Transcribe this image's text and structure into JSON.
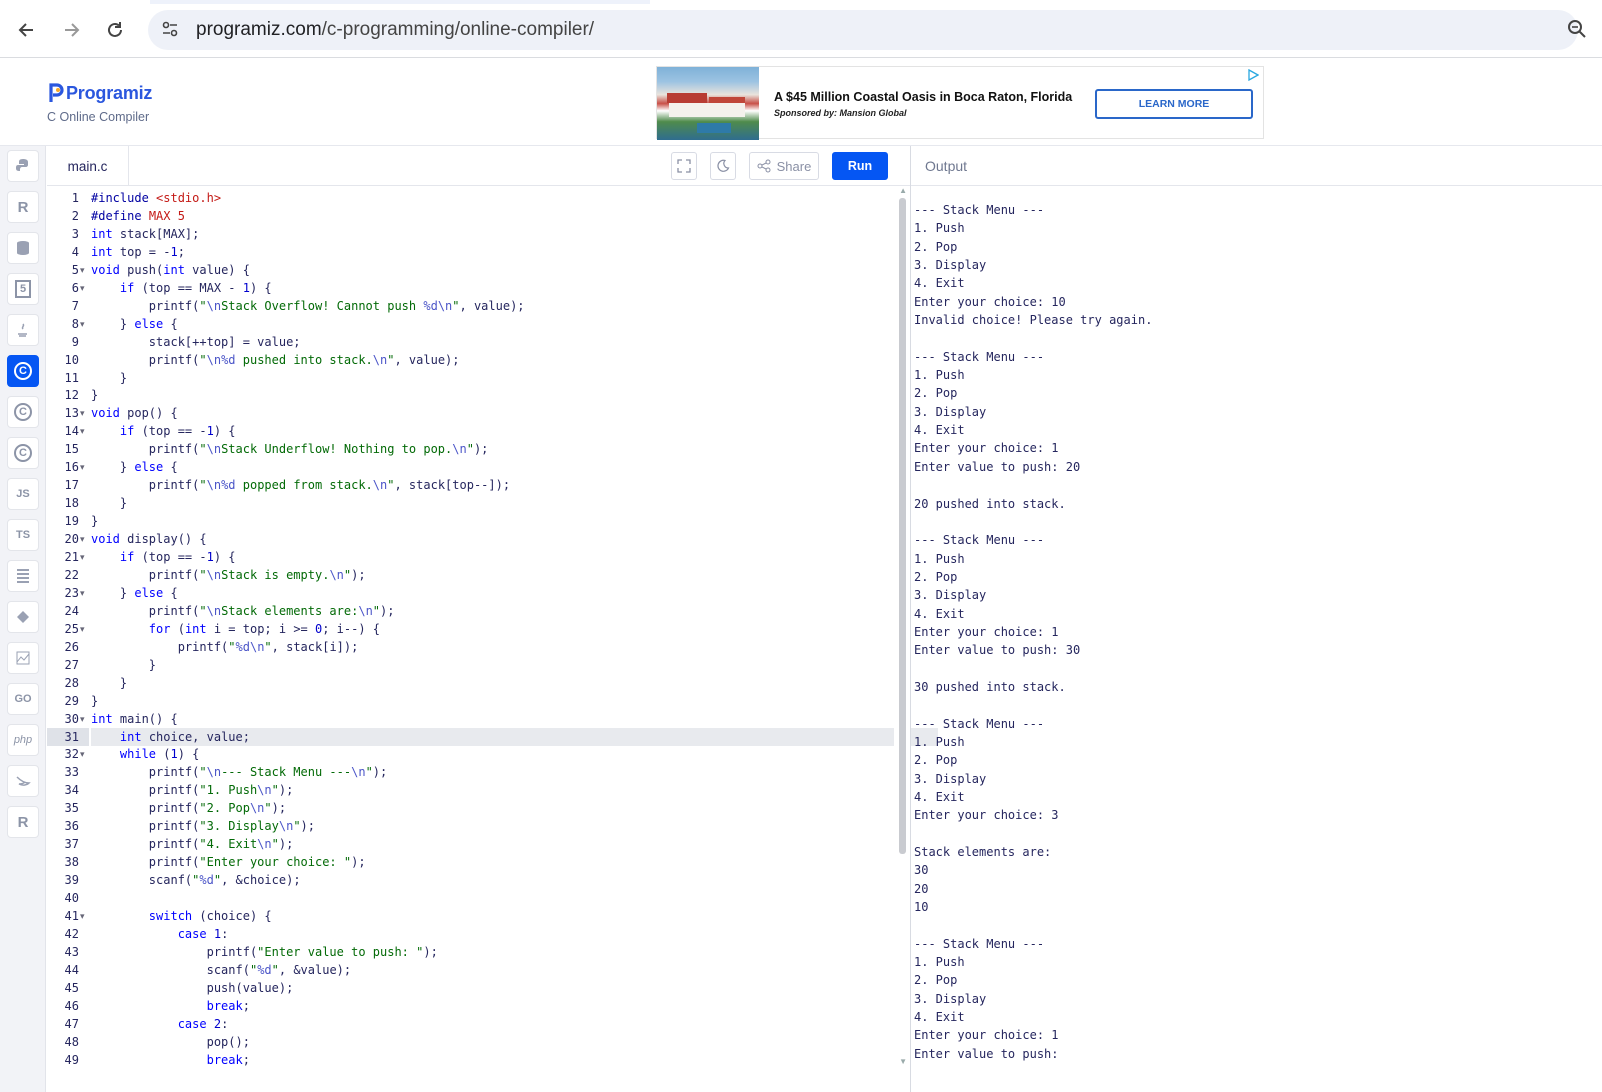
{
  "browser": {
    "url_host": "programiz.com",
    "url_path": "/c-programming/online-compiler/"
  },
  "header": {
    "logo_text": "Programiz",
    "logo_sub": "C Online Compiler"
  },
  "ad": {
    "title": "A $45 Million Coastal Oasis in Boca Raton, Florida",
    "sponsor": "Sponsored by: Mansion Global",
    "button": "LEARN MORE"
  },
  "sidebar": {
    "languages": [
      {
        "name": "python",
        "label": "",
        "active": false
      },
      {
        "name": "r",
        "label": "R",
        "active": false
      },
      {
        "name": "sql",
        "label": "",
        "active": false
      },
      {
        "name": "html",
        "label": "5",
        "active": false
      },
      {
        "name": "java",
        "label": "",
        "active": false
      },
      {
        "name": "c",
        "label": "C",
        "active": true
      },
      {
        "name": "cpp",
        "label": "C",
        "active": false
      },
      {
        "name": "csharp",
        "label": "C",
        "active": false
      },
      {
        "name": "javascript",
        "label": "JS",
        "active": false
      },
      {
        "name": "typescript",
        "label": "TS",
        "active": false
      },
      {
        "name": "go-lang",
        "label": "",
        "active": false
      },
      {
        "name": "kotlin",
        "label": "",
        "active": false
      },
      {
        "name": "rust-img",
        "label": "",
        "active": false
      },
      {
        "name": "go",
        "label": "GO",
        "active": false
      },
      {
        "name": "php",
        "label": "php",
        "active": false
      },
      {
        "name": "swift",
        "label": "",
        "active": false
      },
      {
        "name": "rust",
        "label": "R",
        "active": false
      }
    ]
  },
  "toolbar": {
    "file_name": "main.c",
    "share_label": "Share",
    "run_label": "Run"
  },
  "editor": {
    "active_line": 31,
    "lines": [
      "#include <stdio.h>",
      "#define MAX 5",
      "int stack[MAX];",
      "int top = -1;",
      "void push(int value) {",
      "    if (top == MAX - 1) {",
      "        printf(\"\\nStack Overflow! Cannot push %d\\n\", value);",
      "    } else {",
      "        stack[++top] = value;",
      "        printf(\"\\n%d pushed into stack.\\n\", value);",
      "    }",
      "}",
      "void pop() {",
      "    if (top == -1) {",
      "        printf(\"\\nStack Underflow! Nothing to pop.\\n\");",
      "    } else {",
      "        printf(\"\\n%d popped from stack.\\n\", stack[top--]);",
      "    }",
      "}",
      "void display() {",
      "    if (top == -1) {",
      "        printf(\"\\nStack is empty.\\n\");",
      "    } else {",
      "        printf(\"\\nStack elements are:\\n\");",
      "        for (int i = top; i >= 0; i--) {",
      "            printf(\"%d\\n\", stack[i]);",
      "        }",
      "    }",
      "}",
      "int main() {",
      "    int choice, value;",
      "    while (1) {",
      "        printf(\"\\n--- Stack Menu ---\\n\");",
      "        printf(\"1. Push\\n\");",
      "        printf(\"2. Pop\\n\");",
      "        printf(\"3. Display\\n\");",
      "        printf(\"4. Exit\\n\");",
      "        printf(\"Enter your choice: \");",
      "        scanf(\"%d\", &choice);",
      "",
      "        switch (choice) {",
      "            case 1:",
      "                printf(\"Enter value to push: \");",
      "                scanf(\"%d\", &value);",
      "                push(value);",
      "                break;",
      "            case 2:",
      "                pop();",
      "                break;"
    ],
    "fold_lines": [
      5,
      6,
      8,
      13,
      14,
      16,
      20,
      21,
      23,
      25,
      30,
      32,
      41
    ]
  },
  "output": {
    "title": "Output",
    "lines": [
      "--- Stack Menu ---",
      "1. Push",
      "2. Pop",
      "3. Display",
      "4. Exit",
      "Enter your choice: 10",
      "Invalid choice! Please try again.",
      "",
      "--- Stack Menu ---",
      "1. Push",
      "2. Pop",
      "3. Display",
      "4. Exit",
      "Enter your choice: 1",
      "Enter value to push: 20",
      "",
      "20 pushed into stack.",
      "",
      "--- Stack Menu ---",
      "1. Push",
      "2. Pop",
      "3. Display",
      "4. Exit",
      "Enter your choice: 1",
      "Enter value to push: 30",
      "",
      "30 pushed into stack.",
      "",
      "--- Stack Menu ---",
      "1. Push",
      "2. Pop",
      "3. Display",
      "4. Exit",
      "Enter your choice: 3",
      "",
      "Stack elements are:",
      "30",
      "20",
      "10",
      "",
      "--- Stack Menu ---",
      "1. Push",
      "2. Pop",
      "3. Display",
      "4. Exit",
      "Enter your choice: 1",
      "Enter value to push:"
    ]
  }
}
